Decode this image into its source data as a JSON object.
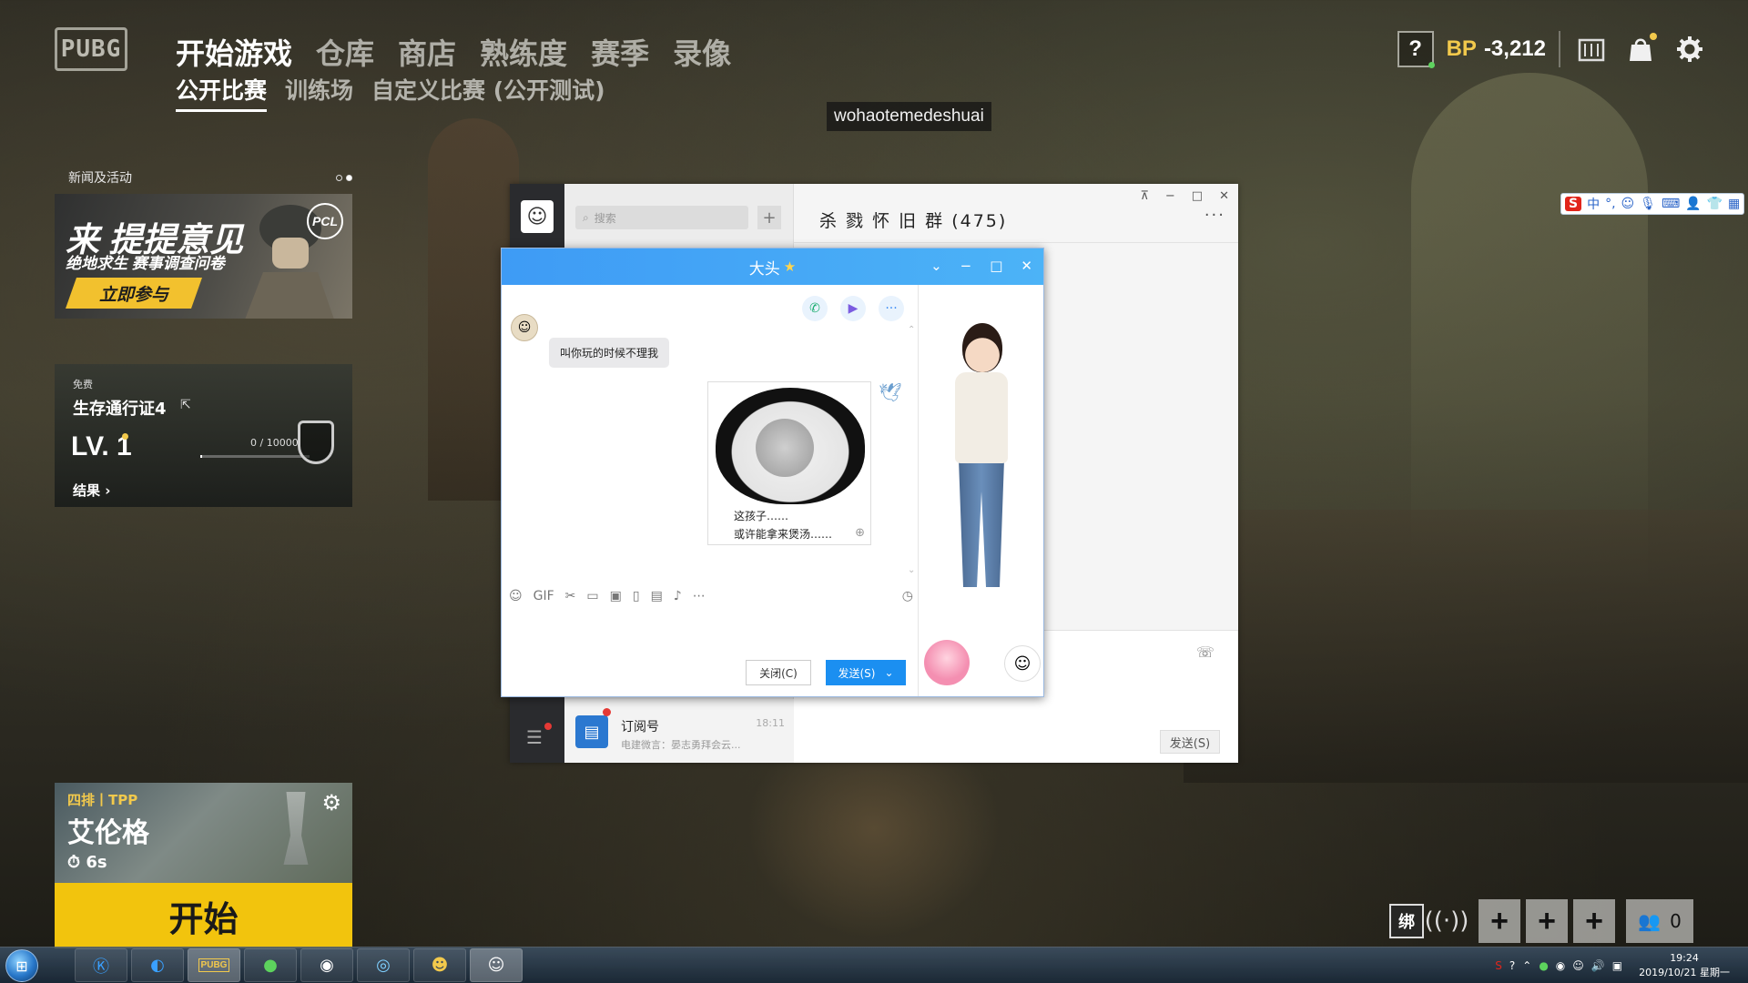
{
  "game": {
    "logo": "PUBG",
    "main_nav": [
      "开始游戏",
      "仓库",
      "商店",
      "熟练度",
      "赛季",
      "录像"
    ],
    "sub_nav": [
      "公开比赛",
      "训练场",
      "自定义比赛 (公开测试)"
    ],
    "bp_label": "BP",
    "bp_value": "-3,212",
    "help_label": "?",
    "username": "wohaotemedeshuai"
  },
  "news": {
    "title": "新闻及活动",
    "banner_line1": "来 提提意见",
    "banner_line2": "绝地求生 赛事调查问卷",
    "banner_cta": "立即参与",
    "banner_badge": "PCL"
  },
  "pass": {
    "free_label": "免费",
    "title": "生存通行证4",
    "level": "LV. 1",
    "progress_text": "0 / 10000",
    "progress_fraction": 0.0,
    "result_label": "结果 ›"
  },
  "match": {
    "mode": "四排丨TPP",
    "map": "艾伦格",
    "timer": "6s",
    "start_label": "开始"
  },
  "squad": {
    "bind_label": "绑",
    "slot_label": "+",
    "party_count": "0"
  },
  "ime": {
    "logo": "S",
    "mode": "中",
    "punct": "°,"
  },
  "qq_main": {
    "search_placeholder": "搜索",
    "add_label": "+",
    "chat_title": "杀 戮 怀 旧 群 (475)",
    "more_label": "···",
    "win_controls": [
      "⊼",
      "−",
      "□",
      "✕"
    ],
    "send_label": "发送(S)",
    "subscription": {
      "name": "订阅号",
      "time": "18:11",
      "preview": "电建微言：晏志勇拜会云..."
    }
  },
  "chat_popup": {
    "title": "大头",
    "incoming_message": "叫你玩的时候不理我",
    "sticker_caption_1": "这孩子……",
    "sticker_caption_2": "或许能拿来煲汤……",
    "close_label": "关闭(C)",
    "send_label": "发送(S)",
    "controls": [
      "⌄",
      "−",
      "□",
      "✕"
    ]
  },
  "taskbar": {
    "time": "19:24",
    "date": "2019/10/21 星期一"
  }
}
